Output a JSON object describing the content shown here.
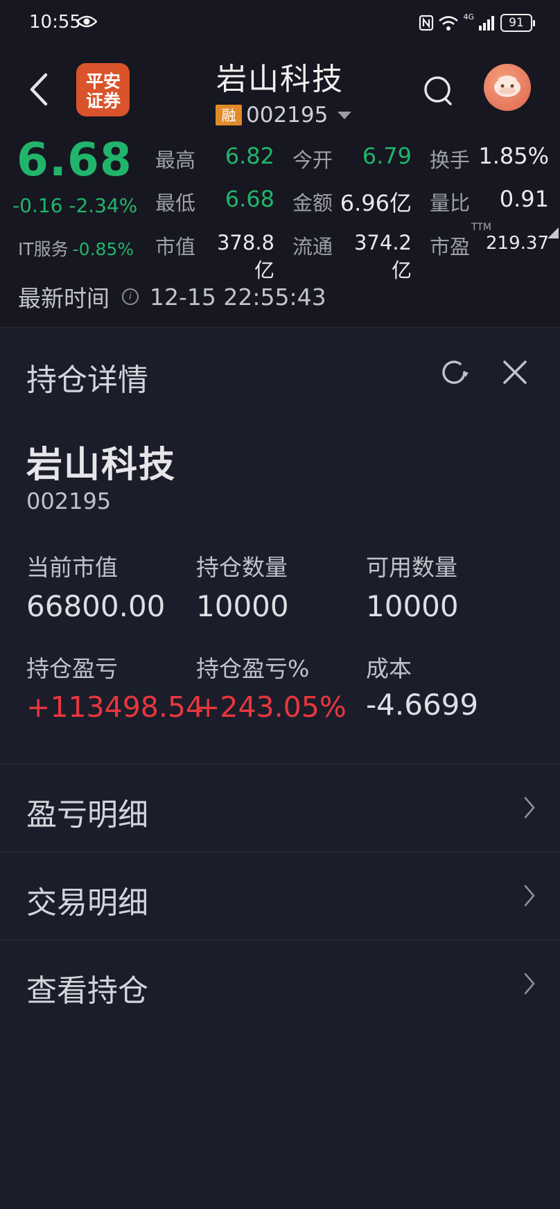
{
  "status_bar": {
    "time": "10:55",
    "battery": "91",
    "network": "4G"
  },
  "header": {
    "title": "岩山科技",
    "margin_badge": "融",
    "code": "002195",
    "broker_logo_text": [
      "平安",
      "证券"
    ]
  },
  "quote": {
    "price": "6.68",
    "change": "-0.16 -2.34%",
    "sector_name": "IT服务",
    "sector_change": "-0.85%",
    "fields": [
      {
        "label": "最高",
        "value": "6.82"
      },
      {
        "label": "今开",
        "value": "6.79"
      },
      {
        "label": "换手",
        "value": "1.85%"
      },
      {
        "label": "最低",
        "value": "6.68"
      },
      {
        "label": "金额",
        "value": "6.96亿"
      },
      {
        "label": "量比",
        "value": "0.91"
      },
      {
        "label": "市值",
        "value": "378.8亿"
      },
      {
        "label": "流通",
        "value": "374.2亿"
      },
      {
        "label": "市盈",
        "value": "219.37"
      }
    ],
    "ttm": "TTM",
    "update_label": "最新时间",
    "update_time": "12-15 22:55:43"
  },
  "position": {
    "title": "持仓详情",
    "name": "岩山科技",
    "code": "002195",
    "metrics": [
      {
        "label": "当前市值",
        "value": "66800.00"
      },
      {
        "label": "持仓数量",
        "value": "10000"
      },
      {
        "label": "可用数量",
        "value": "10000"
      },
      {
        "label": "持仓盈亏",
        "value": "+113498.54"
      },
      {
        "label": "持仓盈亏%",
        "value": "+243.05%"
      },
      {
        "label": "成本",
        "value": "-4.6699"
      }
    ]
  },
  "menu": [
    {
      "label": "盈亏明细"
    },
    {
      "label": "交易明细"
    },
    {
      "label": "查看持仓"
    }
  ],
  "colors": {
    "up": "#e8373d",
    "down": "#21b56b",
    "bg": "#1c1d2a",
    "header_bg": "#161720",
    "margin_badge": "#e08a2a"
  }
}
